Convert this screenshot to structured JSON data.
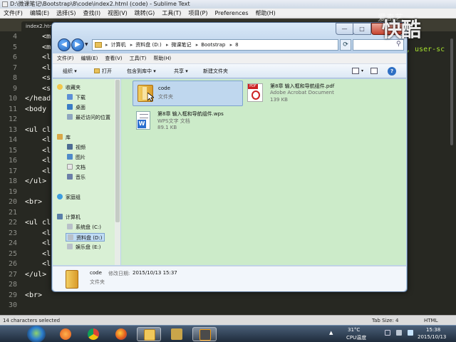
{
  "sublime": {
    "title": "D:\\微课笔记\\Bootstrap\\8\\code\\index2.html (code) - Sublime Text",
    "menu": [
      "文件(F)",
      "编辑(E)",
      "选择(S)",
      "查找(I)",
      "视图(V)",
      "跳转(G)",
      "工具(T)",
      "项目(P)",
      "Preferences",
      "帮助(H)"
    ],
    "tab_label": "index2.html",
    "line_numbers": [
      "4",
      "5",
      "6",
      "7",
      "8",
      "9",
      "10",
      "11",
      "12",
      "13",
      "14",
      "15",
      "16",
      "17",
      "18",
      "19",
      "20",
      "21",
      "22",
      "23",
      "24",
      "25",
      "26",
      "27",
      "28",
      "29",
      "30"
    ],
    "code_lines": [
      "    <m",
      "    <m",
      "    <l",
      "    <l",
      "    <s",
      "    <s",
      "</head",
      "<body",
      "",
      "<ul cl",
      "    <l",
      "    <l",
      "    <l",
      "    <l",
      "</ul>",
      "",
      "<br>",
      "",
      "<ul cl",
      "    <l",
      "    <l",
      "    <l",
      "    <l",
      "</ul>",
      "",
      "<br>",
      ""
    ],
    "right_code": ", user-sc",
    "status_left": "14 characters selected",
    "status_tab": "Tab Size: 4",
    "status_syntax": "HTML"
  },
  "watermark": {
    "text": "快酷",
    "sub": "爱奇艺"
  },
  "explorer": {
    "window_buttons": {
      "minimize": "—",
      "maximize": "□",
      "close": "✕"
    },
    "breadcrumb": [
      "计算机",
      "资料盘 (D:)",
      "微课笔记",
      "Bootstrap",
      "8"
    ],
    "breadcrumb_sep": "▸",
    "menu": [
      "文件(F)",
      "编辑(E)",
      "查看(V)",
      "工具(T)",
      "帮助(H)"
    ],
    "toolbar": {
      "organize": "组织 ▾",
      "open": "打开",
      "include_in_library": "包含到库中 ▾",
      "share": "共享 ▾",
      "new_folder": "新建文件夹"
    },
    "nav": {
      "favorites": "收藏夹",
      "downloads": "下载",
      "desktop": "桌面",
      "recent": "最近访问的位置",
      "libraries": "库",
      "videos": "视频",
      "pictures": "图片",
      "documents": "文档",
      "music": "音乐",
      "homegroup": "家庭组",
      "computer": "计算机",
      "drive_c": "系统盘 (C:)",
      "drive_d": "资料盘 (D:)",
      "drive_e": "娱乐盘 (E:)"
    },
    "files": [
      {
        "name": "code",
        "type": "文件夹",
        "size": "",
        "icon": "folder-icon"
      },
      {
        "name": "第8章 输入框和导航组件.pdf",
        "type": "Adobe Acrobat Document",
        "size": "139 KB",
        "icon": "pdf-icon"
      },
      {
        "name": "第8章 输入框和导航组件.wps",
        "type": "WPS文字 文档",
        "size": "89.1 KB",
        "icon": "wps-icon"
      }
    ],
    "details": {
      "name": "code",
      "modified_label": "修改日期:",
      "modified_value": "2015/10/13 15:37",
      "type": "文件夹"
    }
  },
  "taskbar": {
    "temp": "31°C",
    "cpu": "CPU温度",
    "time": "15:38",
    "date": "2015/10/13"
  }
}
